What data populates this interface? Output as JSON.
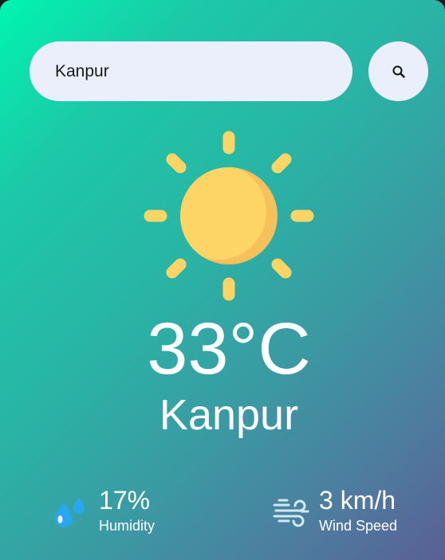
{
  "search": {
    "value": "Kanpur",
    "button_icon": "search-icon"
  },
  "weather": {
    "icon": "sun-icon",
    "temperature": "33°C",
    "city": "Kanpur"
  },
  "details": {
    "humidity": {
      "icon": "humidity-icon",
      "value": "17%",
      "label": "Humidity"
    },
    "wind": {
      "icon": "wind-icon",
      "value": "3 km/h",
      "label": "Wind Speed"
    }
  },
  "colors": {
    "gradient_start": "#00f5b0",
    "gradient_end": "#5a5f95",
    "input_bg": "#ebeffb",
    "sun_primary": "#fdd567",
    "sun_shade": "#f6c15a"
  }
}
